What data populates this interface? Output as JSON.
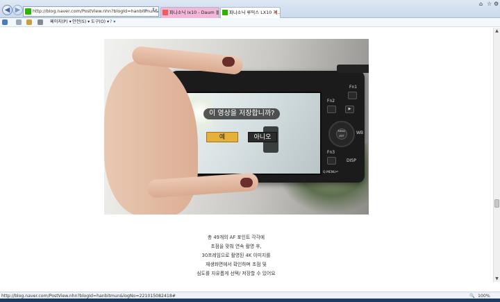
{
  "browser": {
    "address_url": "http://blog.naver.com/PostView.nhn?blogId=hanbitmun&logNo=22101",
    "search_icon": "search-icon",
    "tabs": [
      {
        "label": "파나소닉 lx10 - Daum 통합",
        "color": "#f2b7d8",
        "active": false
      },
      {
        "label": "파나소닉 루믹스 LX10 개...",
        "color": "#ffffff",
        "active": true
      }
    ],
    "accent": "#2db400"
  },
  "command_bar": {
    "page_label": "페이지(P) ▾",
    "safety_label": "안전(S) ▾",
    "tools_label": "도구(O) ▾",
    "help_label": "? ▾"
  },
  "camera_screen": {
    "question": "이 영상을 저장합니까?",
    "yes_label": "예",
    "no_label": "아니오",
    "back_label": "↶",
    "keys": {
      "fn1": "Fn1",
      "fn2": "Fn2",
      "fn3": "Fn3",
      "menu_set": "MENU /SET",
      "wb": "WB",
      "disp": "DISP",
      "menu_back": "Q.MENU↶"
    }
  },
  "caption": {
    "lines": [
      "총 49개의 AF 포인트 각각에",
      "초점을 맞춰 연속 촬영 후,",
      "30프레임으로 촬영된 4K 이미지를",
      "재생화면에서 확인하며 초점 및",
      "심도를 자유롭게 선택/ 저장할 수 있어요"
    ]
  },
  "status": {
    "url": "http://blog.naver.com/PostView.nhn?blogId=hanbitmun&logNo=221015082418#",
    "zoom": "100%"
  }
}
